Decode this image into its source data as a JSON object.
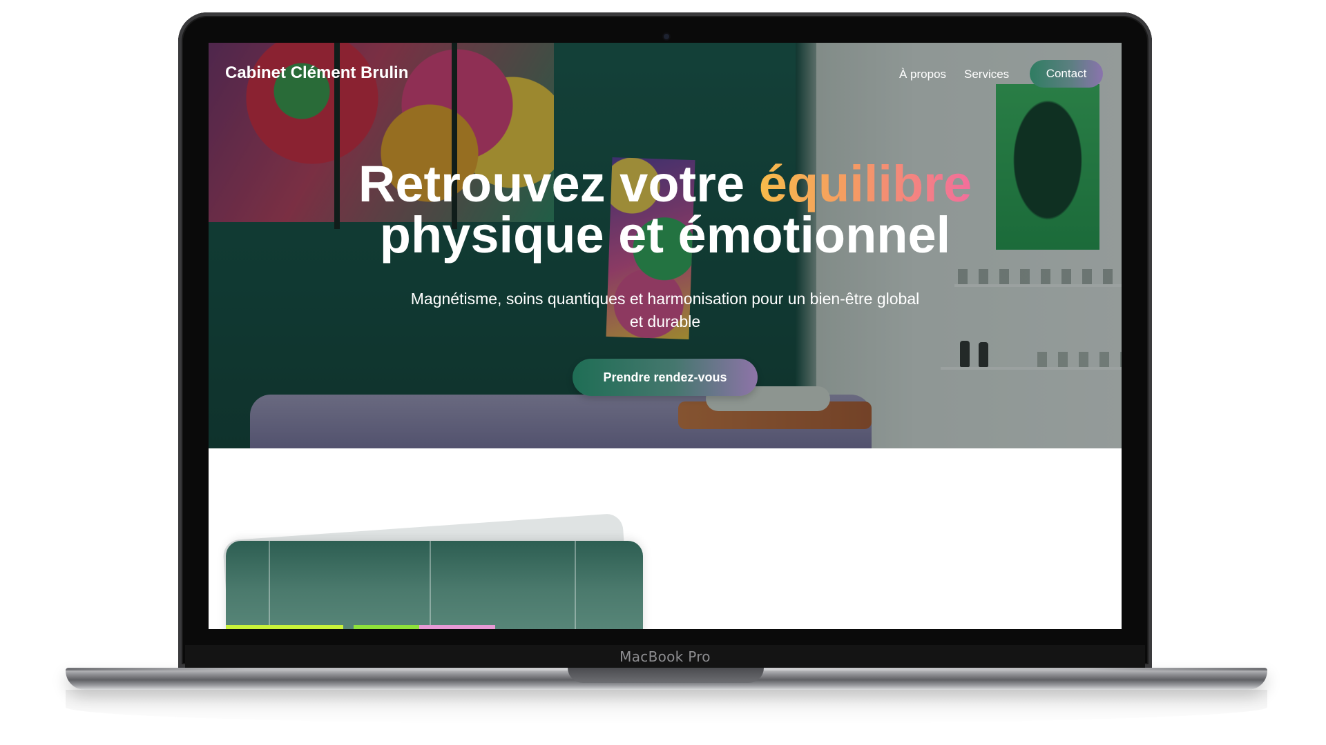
{
  "device": {
    "label": "MacBook Pro"
  },
  "site": {
    "brand": "Cabinet Clément Brulin",
    "nav": {
      "about": "À propos",
      "services": "Services",
      "contact": "Contact"
    },
    "hero": {
      "title_part1": "Retrouvez votre",
      "title_accent": "équilibre",
      "title_part2": "physique et émotionnel",
      "subtitle": "Magnétisme, soins quantiques et harmonisation pour un bien-être global et durable",
      "cta": "Prendre rendez-vous"
    }
  },
  "colors": {
    "accent_gradient_start": "#f7bb4a",
    "accent_gradient_end": "#f26e9c",
    "button_gradient_start": "#1f6e55",
    "button_gradient_end": "#8e74a8"
  }
}
